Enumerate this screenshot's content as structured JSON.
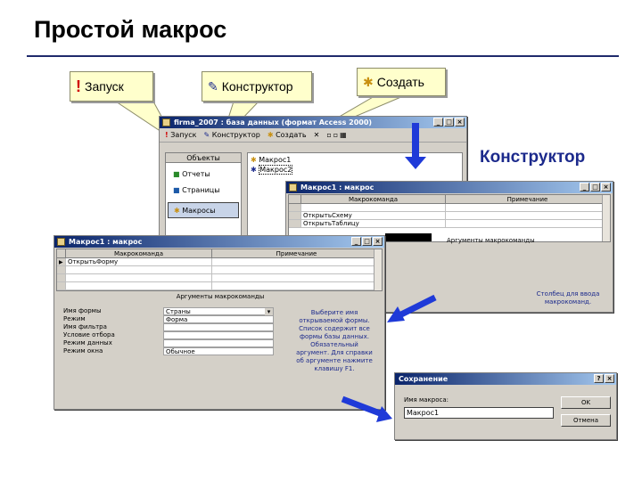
{
  "slide": {
    "title": "Простой макрос",
    "side_caption": "Конструктор"
  },
  "callouts": {
    "run": "Запуск",
    "design": "Конструктор",
    "create": "Создать"
  },
  "db_window": {
    "title": "firma_2007 : база данных (формат Access 2000)",
    "toolbar": {
      "run": "Запуск",
      "design": "Конструктор",
      "create": "Создать"
    },
    "objects_header": "Объекты",
    "objects": [
      "Отчеты",
      "Страницы",
      "Макросы"
    ],
    "macros": [
      "Макрос1",
      "Макрос2"
    ]
  },
  "macro_window_back": {
    "title": "Макрос1 : макрос",
    "col_action": "Макрокоманда",
    "col_note": "Примечание",
    "rows": [
      "",
      "ОткрытьСхему",
      "ОткрытьТаблицу"
    ],
    "args_header": "Аргументы макрокоманды",
    "hint": "Столбец для ввода макрокоманд."
  },
  "macro_window_front": {
    "title": "Макрос1 : макрос",
    "col_action": "Макрокоманда",
    "col_note": "Примечание",
    "rows": [
      "ОткрытьФорму",
      "",
      "",
      ""
    ],
    "args_header": "Аргументы макрокоманды",
    "args": [
      {
        "label": "Имя формы",
        "value": "Страны"
      },
      {
        "label": "Режим",
        "value": "Форма"
      },
      {
        "label": "Имя фильтра",
        "value": ""
      },
      {
        "label": "Условие отбора",
        "value": ""
      },
      {
        "label": "Режим данных",
        "value": ""
      },
      {
        "label": "Режим окна",
        "value": "Обычное"
      }
    ],
    "hint": "Выберите имя открываемой формы. Список содержит все формы базы данных. Обязательный аргумент. Для справки об аргументе нажмите клавишу F1."
  },
  "save_dialog": {
    "title": "Сохранение",
    "label": "Имя макроса:",
    "value": "Макрос1",
    "ok": "OK",
    "cancel": "Отмена"
  }
}
